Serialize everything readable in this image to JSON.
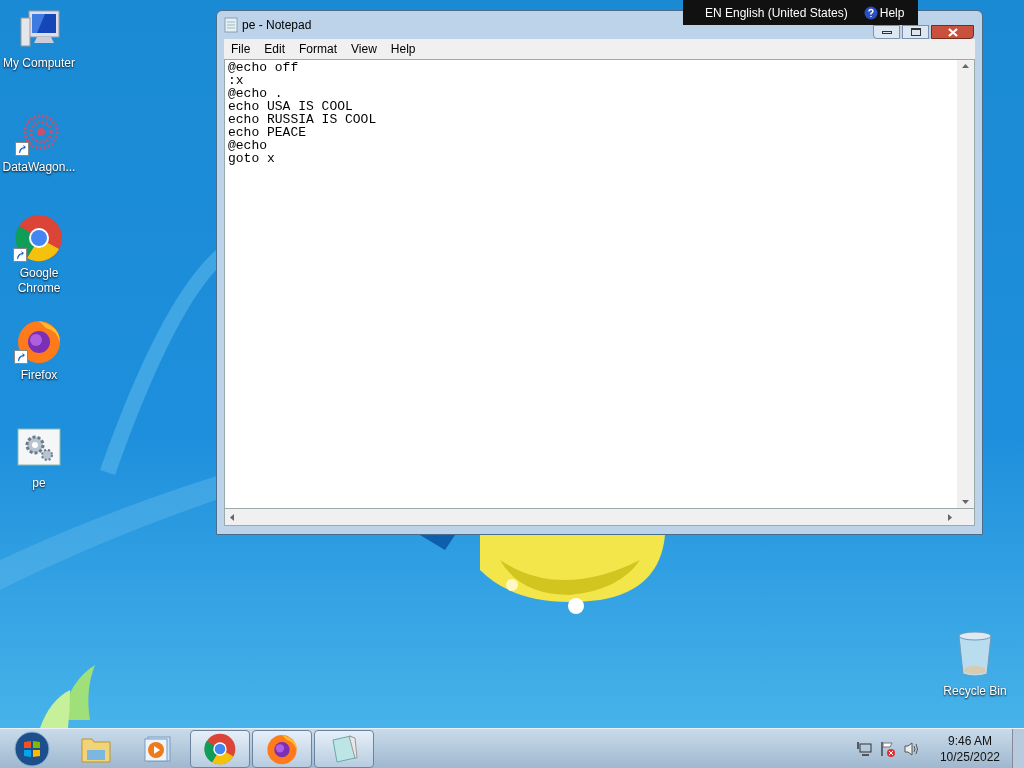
{
  "desktop_icons": [
    {
      "kind": "computer",
      "label": "My Computer",
      "shortcut": false
    },
    {
      "kind": "datawagon",
      "label": "DataWagon...",
      "shortcut": true
    },
    {
      "kind": "chrome",
      "label": "Google Chrome",
      "shortcut": true
    },
    {
      "kind": "firefox",
      "label": "Firefox",
      "shortcut": true
    },
    {
      "kind": "batch",
      "label": "pe",
      "shortcut": false
    }
  ],
  "notepad": {
    "title": "pe - Notepad",
    "menu": [
      "File",
      "Edit",
      "Format",
      "View",
      "Help"
    ],
    "lines": [
      "@echo off",
      ":x",
      "@echo .",
      "echo USA IS COOL",
      "echo RUSSIA IS COOL",
      "echo PEACE",
      "@echo",
      "goto x"
    ]
  },
  "language_bar": {
    "code": "EN",
    "language": "English (United States)",
    "help": "Help"
  },
  "recycle_bin": {
    "label": "Recycle Bin"
  },
  "taskbar": {
    "buttons": [
      {
        "kind": "start",
        "running": false
      },
      {
        "kind": "explorer",
        "running": false
      },
      {
        "kind": "media",
        "running": false
      },
      {
        "kind": "chrome",
        "running": true
      },
      {
        "kind": "firefox",
        "running": true
      },
      {
        "kind": "notepad",
        "running": true
      }
    ],
    "clock": {
      "time": "9:46 AM",
      "date": "10/25/2022"
    }
  }
}
